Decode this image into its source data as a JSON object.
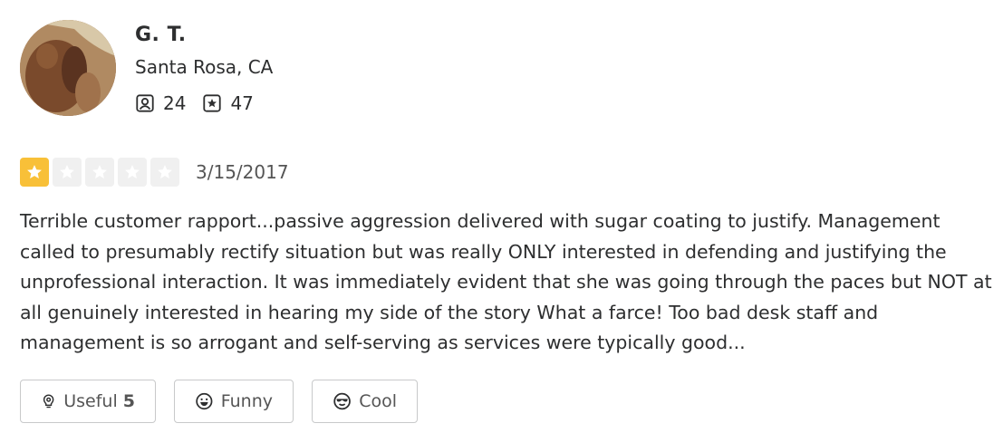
{
  "user": {
    "name": "G. T.",
    "location": "Santa Rosa, CA",
    "friends_count": "24",
    "reviews_count": "47"
  },
  "review": {
    "rating": 1,
    "max_rating": 5,
    "date": "3/15/2017",
    "text": "Terrible customer rapport...passive aggression delivered with sugar coating to justify. Management called to presumably rectify situation but was really ONLY interested in defending and justifying the unprofessional interaction. It was immediately evident that she was going through the paces but NOT at all genuinely interested in hearing my side of the story What a farce! Too bad desk staff and management is so arrogant and self-serving as services were typically good..."
  },
  "reactions": {
    "useful_label": "Useful",
    "useful_count": "5",
    "funny_label": "Funny",
    "cool_label": "Cool"
  },
  "colors": {
    "star_filled": "#f8c038",
    "star_empty": "#f0f0f0"
  },
  "icons": [
    "friends-icon",
    "review-star-icon",
    "star-icon",
    "lightbulb-icon",
    "smile-icon",
    "sunglasses-icon"
  ]
}
